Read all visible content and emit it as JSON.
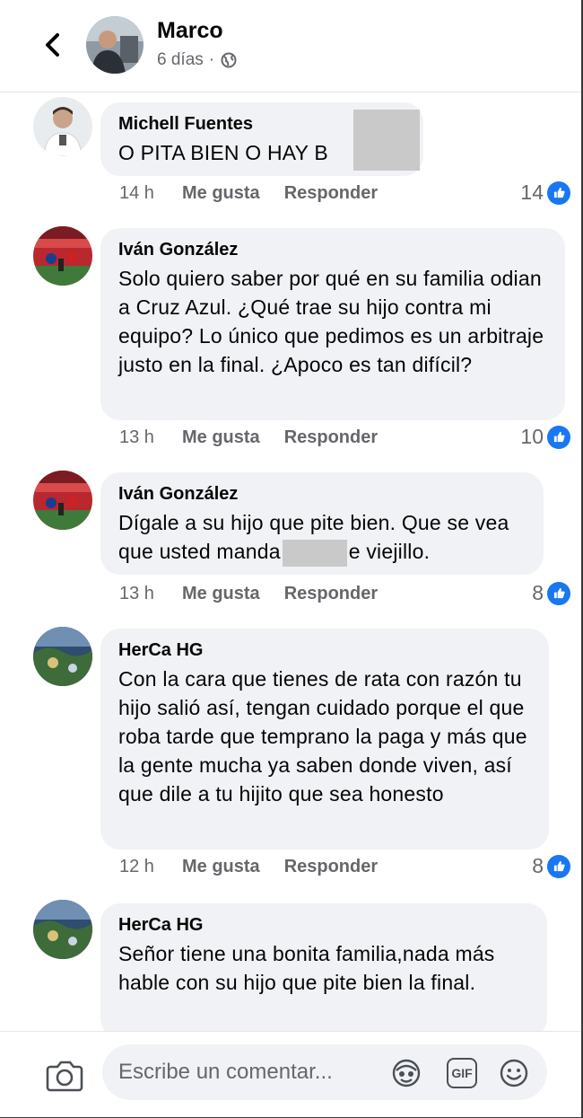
{
  "header": {
    "name": "Marco",
    "time": "6 días",
    "dot": "·"
  },
  "comments": [
    {
      "author": "Michell Fuentes",
      "text": "O PITA BIEN O HAY B",
      "time": "14 h",
      "like": "Me gusta",
      "reply": "Responder",
      "reactions": "14"
    },
    {
      "author": "Iván González",
      "text": "Solo quiero saber por qué en su familia odian a Cruz Azul. ¿Qué trae su hijo contra mi equipo? Lo único que pedimos es un arbitraje justo en la final. ¿Apoco es tan difícil?",
      "time": "13 h",
      "like": "Me gusta",
      "reply": "Responder",
      "reactions": "10"
    },
    {
      "author": "Iván González",
      "text_a": "Dígale a su hijo que pite bien. Que se vea que usted manda",
      "text_b": "e viejillo.",
      "time": "13 h",
      "like": "Me gusta",
      "reply": "Responder",
      "reactions": "8"
    },
    {
      "author": "HerCa HG",
      "text": "Con la cara que tienes de rata con razón tu hijo salió así, tengan cuidado porque el que roba tarde que temprano la paga y más que la gente mucha ya saben donde viven, así que dile a tu hijito que sea honesto",
      "time": "12 h",
      "like": "Me gusta",
      "reply": "Responder",
      "reactions": "8"
    },
    {
      "author": "HerCa HG",
      "text": "Señor tiene una bonita familia,nada más hable con su hijo que pite bien la final."
    }
  ],
  "composer": {
    "placeholder": "Escribe un comentar...",
    "gif_label": "GIF"
  },
  "colors": {
    "like_blue": "#1877f2",
    "bubble_bg": "#f0f2f5",
    "meta_gray": "#65676b"
  }
}
